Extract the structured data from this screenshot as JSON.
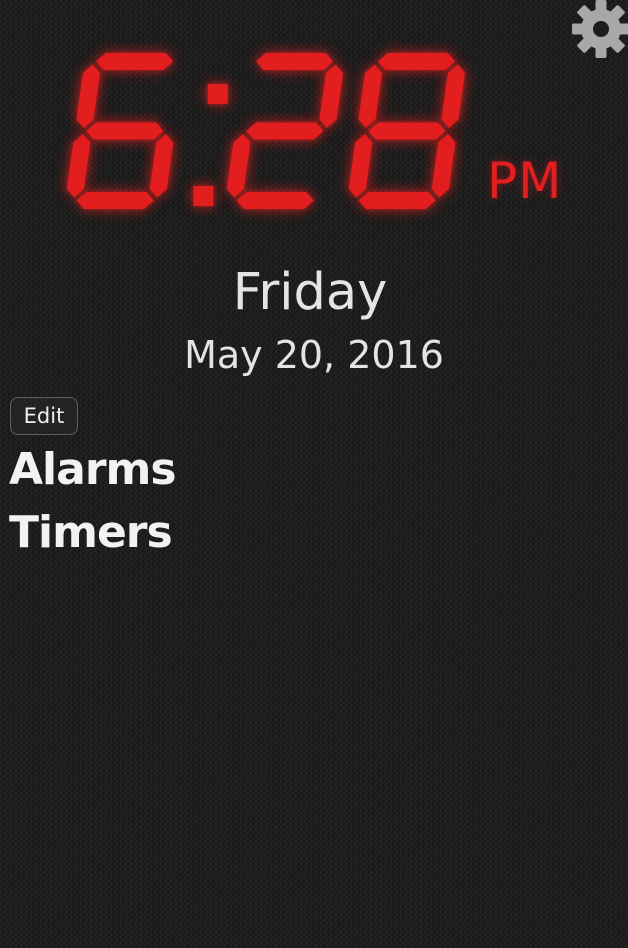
{
  "clock": {
    "time": "6:28",
    "hour": "6",
    "minutes": "28",
    "meridiem": "PM",
    "digit_color": "#e21e1e"
  },
  "date": {
    "day_name": "Friday",
    "full_date": "May 20, 2016"
  },
  "toolbar": {
    "edit_label": "Edit",
    "settings_icon": "gear-icon"
  },
  "sections": {
    "alarms_label": "Alarms",
    "timers_label": "Timers"
  },
  "colors": {
    "background": "#1d1d1d",
    "text": "#e4e4e4",
    "accent": "#e21e1e",
    "gear": "#a8a8a8"
  }
}
